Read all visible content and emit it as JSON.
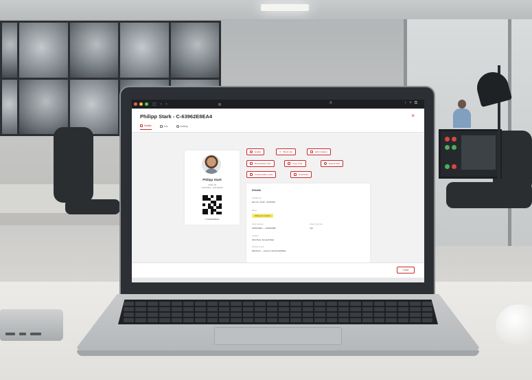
{
  "window": {
    "title": "Philipp Stark - C-63962E8EA4",
    "close_glyph": "×"
  },
  "tabs": [
    {
      "label": "Details",
      "icon": "person-icon",
      "active": true
    },
    {
      "label": "Info",
      "icon": "info-icon",
      "active": false
    },
    {
      "label": "Activity",
      "icon": "clock-icon",
      "active": false
    }
  ],
  "profile": {
    "name": "Philipp Stark",
    "subtitle_line1": "Visitor ID",
    "subtitle_line2": "12/1/2024 - 12/31/2025",
    "qr_code_text": "C-63962E8EA4"
  },
  "actions": [
    {
      "label": "Enable",
      "icon": "person-icon"
    },
    {
      "label": "Block visit",
      "icon": "close-icon"
    },
    {
      "label": "Edit invitation",
      "icon": "edit-icon"
    },
    {
      "label": "Reschedule invite",
      "icon": "calendar-icon"
    },
    {
      "label": "Copy invite",
      "icon": "copy-icon"
    },
    {
      "label": "Extend Visit",
      "icon": "clock-icon"
    },
    {
      "label": "Cancel further visits",
      "icon": "cancel-icon"
    },
    {
      "label": "Deactivate",
      "icon": "deactivate-icon"
    }
  ],
  "details": {
    "heading": "Details",
    "fields": [
      {
        "label": "Invitation for",
        "value": "Dec 11, 12:00 - 13:00 AM"
      },
      {
        "label": "Status",
        "badge": "Waiting for invitation"
      },
      {
        "label": "Visitor approve",
        "value": "10/01/2024 — 12/01/2026"
      },
      {
        "label": "Active check-out",
        "value": "Yes"
      },
      {
        "label": "Location",
        "value": "First Floor, Ground Rear"
      },
      {
        "label": "Purpose of visit",
        "value": "Meetnote — meet to call accessibility"
      }
    ]
  },
  "footer": {
    "close_label": "Close"
  },
  "colors": {
    "accent": "#c5282a",
    "badge": "#f7e770"
  }
}
